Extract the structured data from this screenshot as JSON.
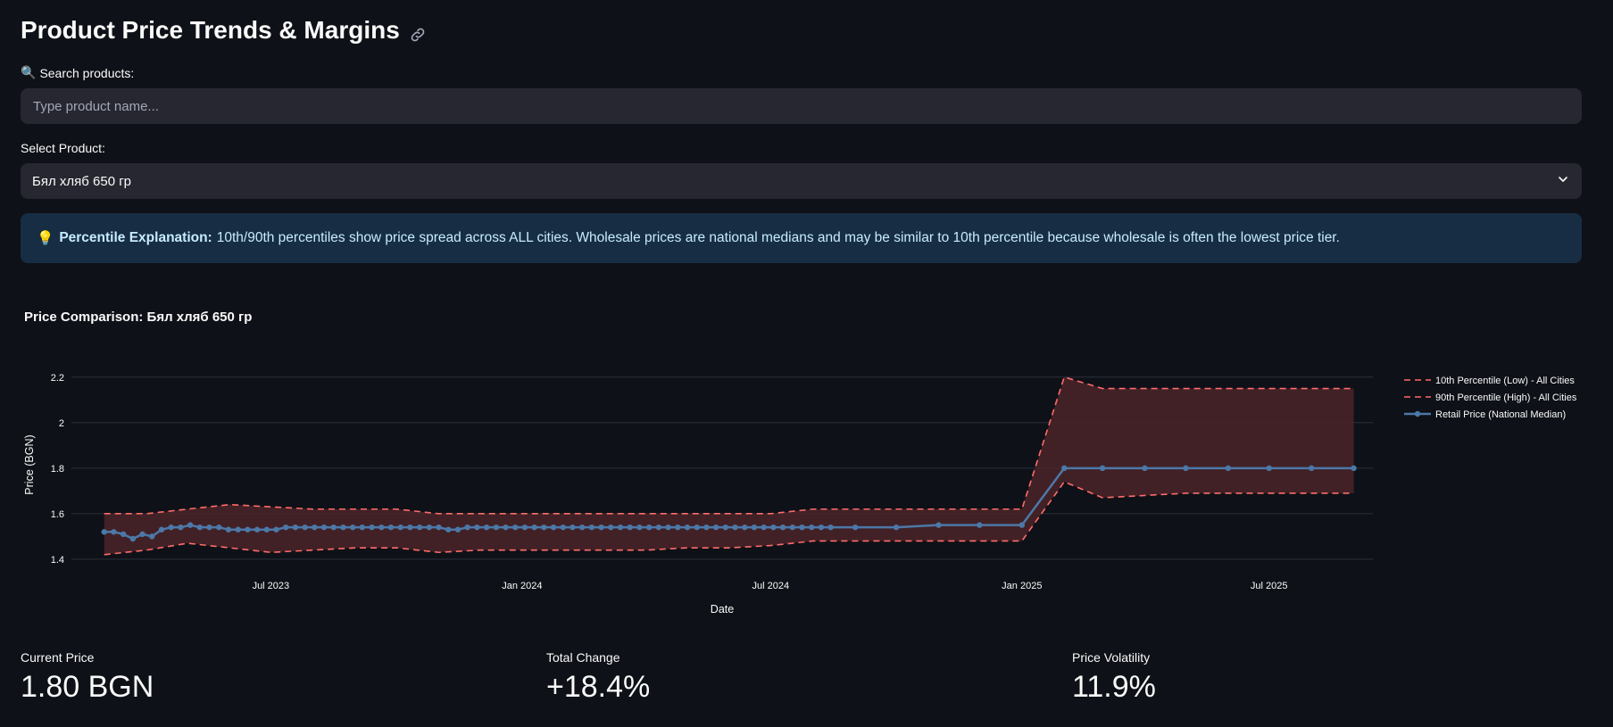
{
  "page": {
    "title": "Product Price Trends & Margins"
  },
  "search": {
    "label": "Search products:",
    "placeholder": "Type product name...",
    "value": ""
  },
  "select": {
    "label": "Select Product:",
    "value": "Бял хляб 650 гр"
  },
  "info": {
    "emoji": "💡",
    "bold": "Percentile Explanation:",
    "text": "10th/90th percentiles show price spread across ALL cities. Wholesale prices are national medians and may be similar to 10th percentile because wholesale is often the lowest price tier."
  },
  "metrics": [
    {
      "label": "Current Price",
      "value": "1.80 BGN"
    },
    {
      "label": "Total Change",
      "value": "+18.4%"
    },
    {
      "label": "Price Volatility",
      "value": "11.9%"
    }
  ],
  "colors": {
    "background": "#0e1117",
    "input_bg": "#262730",
    "info_bg": "#172d43",
    "retail_line": "#4c78a8",
    "percentile_line": "#ff6b6b",
    "band_fill": "#4a2529"
  },
  "chart_data": {
    "type": "line",
    "title": "Price Comparison: Бял хляб 650 гр",
    "xlabel": "Date",
    "ylabel": "Price (BGN)",
    "ylim": [
      1.38,
      2.25
    ],
    "yticks": [
      1.4,
      1.6,
      1.8,
      2.0,
      2.2
    ],
    "ytick_labels": [
      "1.4",
      "1.6",
      "1.8",
      "2",
      "2.2"
    ],
    "xlim": [
      "2023-02-05",
      "2025-09-15"
    ],
    "xticks": [
      "2023-07-01",
      "2024-01-01",
      "2024-07-01",
      "2025-01-01",
      "2025-07-01"
    ],
    "xtick_labels": [
      "Jul 2023",
      "Jan 2024",
      "Jul 2024",
      "Jan 2025",
      "Jul 2025"
    ],
    "grid": true,
    "legend_position": "right",
    "series": [
      {
        "name": "10th Percentile (Low) - All Cities",
        "style": "dashed",
        "x": [
          "2023-03-01",
          "2023-04-01",
          "2023-05-01",
          "2023-06-01",
          "2023-07-01",
          "2023-08-01",
          "2023-09-01",
          "2023-10-01",
          "2023-11-01",
          "2023-12-01",
          "2024-01-01",
          "2024-02-01",
          "2024-03-01",
          "2024-04-01",
          "2024-05-01",
          "2024-06-01",
          "2024-07-01",
          "2024-08-01",
          "2024-09-01",
          "2024-10-01",
          "2024-11-01",
          "2024-12-01",
          "2025-01-01",
          "2025-02-01",
          "2025-03-01",
          "2025-04-01",
          "2025-05-01",
          "2025-06-01",
          "2025-07-01",
          "2025-08-01",
          "2025-09-01"
        ],
        "values": [
          1.42,
          1.44,
          1.47,
          1.45,
          1.43,
          1.44,
          1.45,
          1.45,
          1.43,
          1.44,
          1.44,
          1.44,
          1.44,
          1.44,
          1.45,
          1.45,
          1.46,
          1.48,
          1.48,
          1.48,
          1.48,
          1.48,
          1.48,
          1.74,
          1.67,
          1.68,
          1.69,
          1.69,
          1.69,
          1.69,
          1.69
        ]
      },
      {
        "name": "90th Percentile (High) - All Cities",
        "style": "dashed",
        "x": [
          "2023-03-01",
          "2023-04-01",
          "2023-05-01",
          "2023-06-01",
          "2023-07-01",
          "2023-08-01",
          "2023-09-01",
          "2023-10-01",
          "2023-11-01",
          "2023-12-01",
          "2024-01-01",
          "2024-02-01",
          "2024-03-01",
          "2024-04-01",
          "2024-05-01",
          "2024-06-01",
          "2024-07-01",
          "2024-08-01",
          "2024-09-01",
          "2024-10-01",
          "2024-11-01",
          "2024-12-01",
          "2025-01-01",
          "2025-02-01",
          "2025-03-01",
          "2025-04-01",
          "2025-05-01",
          "2025-06-01",
          "2025-07-01",
          "2025-08-01",
          "2025-09-01"
        ],
        "values": [
          1.6,
          1.6,
          1.62,
          1.64,
          1.63,
          1.62,
          1.62,
          1.62,
          1.6,
          1.6,
          1.6,
          1.6,
          1.6,
          1.6,
          1.6,
          1.6,
          1.6,
          1.62,
          1.62,
          1.62,
          1.62,
          1.62,
          1.62,
          2.2,
          2.15,
          2.15,
          2.15,
          2.15,
          2.15,
          2.15,
          2.15
        ]
      },
      {
        "name": "Retail Price (National Median)",
        "style": "solid-markers",
        "x": [
          "2023-03-01",
          "2023-03-08",
          "2023-03-15",
          "2023-03-22",
          "2023-03-29",
          "2023-04-05",
          "2023-04-12",
          "2023-04-19",
          "2023-04-26",
          "2023-05-03",
          "2023-05-10",
          "2023-05-17",
          "2023-05-24",
          "2023-05-31",
          "2023-06-07",
          "2023-06-14",
          "2023-06-21",
          "2023-06-28",
          "2023-07-05",
          "2023-07-12",
          "2023-07-19",
          "2023-07-26",
          "2023-08-02",
          "2023-08-09",
          "2023-08-16",
          "2023-08-23",
          "2023-08-30",
          "2023-09-06",
          "2023-09-13",
          "2023-09-20",
          "2023-09-27",
          "2023-10-04",
          "2023-10-11",
          "2023-10-18",
          "2023-10-25",
          "2023-11-01",
          "2023-11-08",
          "2023-11-15",
          "2023-11-22",
          "2023-11-29",
          "2023-12-06",
          "2023-12-13",
          "2023-12-20",
          "2023-12-27",
          "2024-01-03",
          "2024-01-10",
          "2024-01-17",
          "2024-01-24",
          "2024-01-31",
          "2024-02-07",
          "2024-02-14",
          "2024-02-21",
          "2024-02-28",
          "2024-03-06",
          "2024-03-13",
          "2024-03-20",
          "2024-03-27",
          "2024-04-03",
          "2024-04-10",
          "2024-04-17",
          "2024-04-24",
          "2024-05-01",
          "2024-05-08",
          "2024-05-15",
          "2024-05-22",
          "2024-05-29",
          "2024-06-05",
          "2024-06-12",
          "2024-06-19",
          "2024-06-26",
          "2024-07-03",
          "2024-07-10",
          "2024-07-17",
          "2024-07-24",
          "2024-07-31",
          "2024-08-07",
          "2024-08-14",
          "2024-09-01",
          "2024-10-01",
          "2024-11-01",
          "2024-12-01",
          "2025-01-01",
          "2025-02-01",
          "2025-03-01",
          "2025-04-01",
          "2025-05-01",
          "2025-06-01",
          "2025-07-01",
          "2025-08-01",
          "2025-09-01"
        ],
        "values": [
          1.52,
          1.52,
          1.51,
          1.49,
          1.51,
          1.5,
          1.53,
          1.54,
          1.54,
          1.55,
          1.54,
          1.54,
          1.54,
          1.53,
          1.53,
          1.53,
          1.53,
          1.53,
          1.53,
          1.54,
          1.54,
          1.54,
          1.54,
          1.54,
          1.54,
          1.54,
          1.54,
          1.54,
          1.54,
          1.54,
          1.54,
          1.54,
          1.54,
          1.54,
          1.54,
          1.54,
          1.53,
          1.53,
          1.54,
          1.54,
          1.54,
          1.54,
          1.54,
          1.54,
          1.54,
          1.54,
          1.54,
          1.54,
          1.54,
          1.54,
          1.54,
          1.54,
          1.54,
          1.54,
          1.54,
          1.54,
          1.54,
          1.54,
          1.54,
          1.54,
          1.54,
          1.54,
          1.54,
          1.54,
          1.54,
          1.54,
          1.54,
          1.54,
          1.54,
          1.54,
          1.54,
          1.54,
          1.54,
          1.54,
          1.54,
          1.54,
          1.54,
          1.54,
          1.54,
          1.55,
          1.55,
          1.55,
          1.8,
          1.8,
          1.8,
          1.8,
          1.8,
          1.8,
          1.8,
          1.8
        ]
      }
    ]
  }
}
